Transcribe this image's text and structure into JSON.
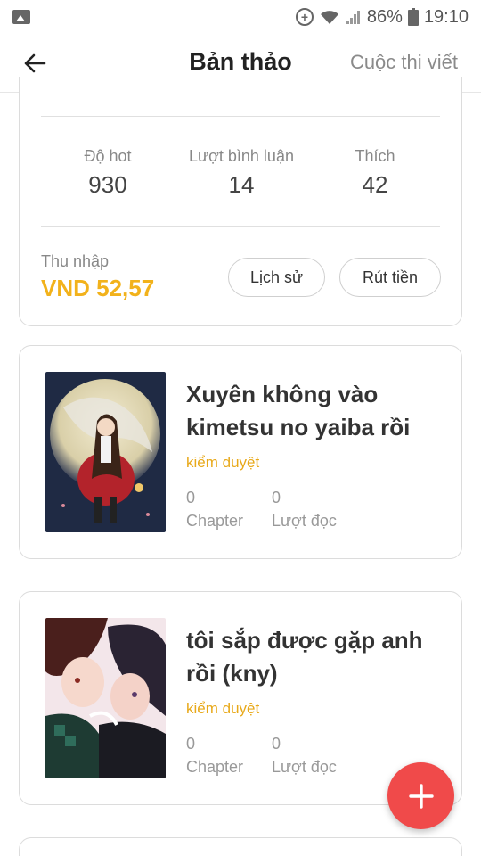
{
  "status_bar": {
    "battery": "86%",
    "time": "19:10",
    "icons": [
      "gallery-icon",
      "data-saver-icon",
      "wifi-icon",
      "signal-icon",
      "battery-icon"
    ]
  },
  "header": {
    "title": "Bản thảo",
    "contest_link": "Cuộc thi viết",
    "back_icon": "arrow-left-icon"
  },
  "stats": {
    "hot_label": "Độ hot",
    "hot_value": "930",
    "comments_label": "Lượt bình luận",
    "comments_value": "14",
    "likes_label": "Thích",
    "likes_value": "42"
  },
  "income": {
    "label": "Thu nhập",
    "value": "VND 52,57",
    "history_button": "Lịch sử",
    "withdraw_button": "Rút tiền"
  },
  "stories": [
    {
      "title": "Xuyên không vào kimetsu no yaiba rồi",
      "status": "kiểm duyệt",
      "chapters_value": "0",
      "chapters_label": "Chapter",
      "reads_value": "0",
      "reads_label": "Lượt đọc"
    },
    {
      "title": "tôi sắp được gặp anh rồi (kny)",
      "status": "kiểm duyệt",
      "chapters_value": "0",
      "chapters_label": "Chapter",
      "reads_value": "0",
      "reads_label": "Lượt đọc"
    }
  ],
  "fab": {
    "icon": "plus-icon"
  },
  "colors": {
    "accent_income": "#f2b21b",
    "status_color": "#e8a91a",
    "fab": "#f04a4a"
  }
}
